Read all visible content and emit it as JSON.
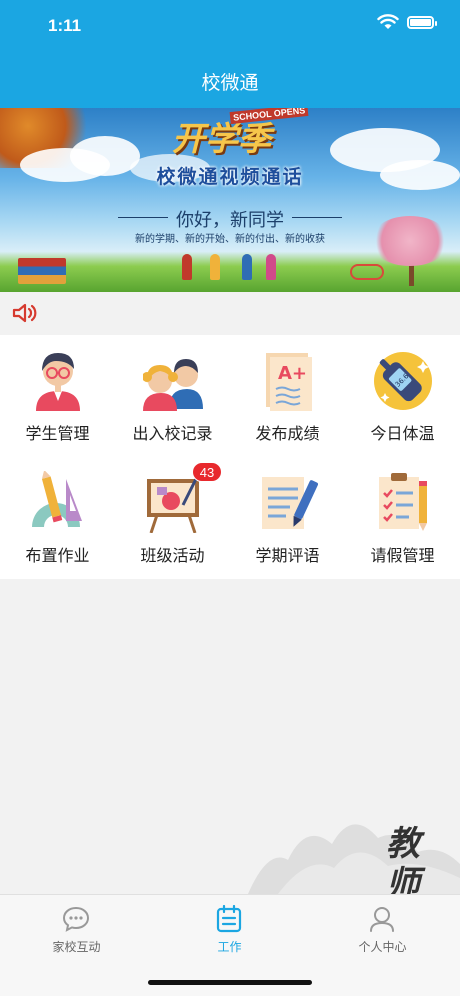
{
  "status_bar": {
    "time": "1:11"
  },
  "nav": {
    "title": "校微通"
  },
  "banner": {
    "logo_text": "开学季",
    "logo_en": "SCHOOL OPENS",
    "headline": "校微通视频通话",
    "greeting": "你好，新同学",
    "slogan": "新的学期、新的开始、新的付出、新的收获"
  },
  "grid": {
    "items": [
      {
        "label": "学生管理",
        "icon": "student-icon"
      },
      {
        "label": "出入校记录",
        "icon": "people-icon"
      },
      {
        "label": "发布成绩",
        "icon": "grade-paper-icon"
      },
      {
        "label": "今日体温",
        "icon": "thermometer-icon"
      },
      {
        "label": "布置作业",
        "icon": "ruler-pencil-icon"
      },
      {
        "label": "班级活动",
        "icon": "easel-icon",
        "badge": "43"
      },
      {
        "label": "学期评语",
        "icon": "document-pen-icon"
      },
      {
        "label": "请假管理",
        "icon": "checklist-icon"
      }
    ]
  },
  "decoration": {
    "calligraphy": "教师"
  },
  "tabbar": {
    "tabs": [
      {
        "label": "家校互动",
        "icon": "chat-icon",
        "active": false
      },
      {
        "label": "工作",
        "icon": "work-clipboard-icon",
        "active": true
      },
      {
        "label": "个人中心",
        "icon": "person-icon",
        "active": false
      }
    ]
  },
  "colors": {
    "primary": "#1ba6e2",
    "badge": "#e8292d",
    "speaker": "#d63a2f"
  }
}
